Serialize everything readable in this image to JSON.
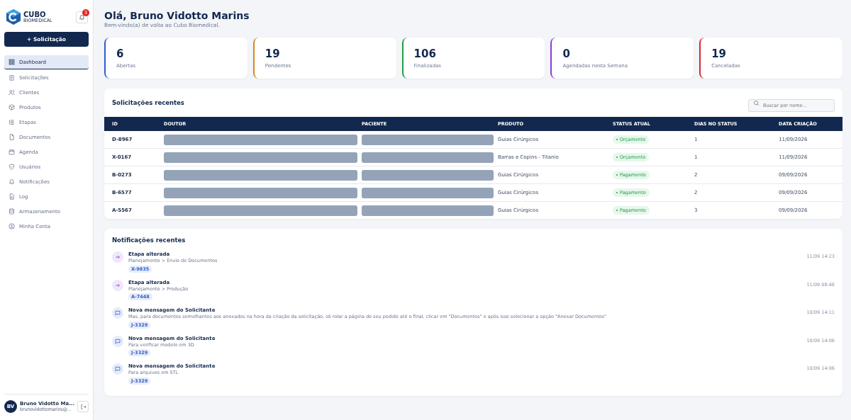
{
  "sidebar": {
    "logo": {
      "name": "CUBO",
      "tagline": "BIOMEDICAL"
    },
    "notification_count": "3",
    "new_button": {
      "icon": "+",
      "label": "Solicitação"
    },
    "items": [
      {
        "label": "Dashboard",
        "selected": true
      },
      {
        "label": "Solicitações",
        "selected": false
      },
      {
        "label": "Clientes",
        "selected": false
      },
      {
        "label": "Produtos",
        "selected": false
      },
      {
        "label": "Etapas",
        "selected": false
      },
      {
        "label": "Documentos",
        "selected": false
      },
      {
        "label": "Agenda",
        "selected": false
      },
      {
        "label": "Usuários",
        "selected": false
      },
      {
        "label": "Notificações",
        "selected": false
      },
      {
        "label": "Log",
        "selected": false
      },
      {
        "label": "Armazenamento",
        "selected": false
      },
      {
        "label": "Minha Conta",
        "selected": false
      }
    ],
    "user": {
      "initials": "BV",
      "name": "Bruno Vidotto Ma...",
      "email": "brunovidottomarins@..."
    }
  },
  "header": {
    "title": "Olá, Bruno Vidotto Marins",
    "subtitle": "Bem-vindo(a) de volta ao Cubo Biomedical."
  },
  "stats": [
    {
      "value": "6",
      "label": "Abertas",
      "color": "#2f5fd0"
    },
    {
      "value": "19",
      "label": "Pendentes",
      "color": "#d98a1c"
    },
    {
      "value": "106",
      "label": "Finalizadas",
      "color": "#1f9d4a"
    },
    {
      "value": "0",
      "label": "Agendadas nesta Semana",
      "color": "#8b3fd9"
    },
    {
      "value": "19",
      "label": "Canceladas",
      "color": "#d42b2b"
    }
  ],
  "requests": {
    "title": "Solicitações recentes",
    "search": {
      "placeholder": "Buscar por nome..."
    },
    "columns": [
      "ID",
      "DOUTOR",
      "PACIENTE",
      "PRODUTO",
      "STATUS ATUAL",
      "DIAS NO STATUS",
      "DATA CRIAÇÃO"
    ],
    "rows": [
      {
        "id": "D-8967",
        "doctor_redacted": true,
        "patient_redacted": true,
        "product": "Guias Cirúrgicos",
        "status": "Orçamento",
        "days": "1",
        "created": "11/09/2026"
      },
      {
        "id": "X-0167",
        "doctor_redacted": true,
        "patient_redacted": true,
        "product": "Barras e Copins - Titanio",
        "status": "Orçamento",
        "days": "1",
        "created": "11/09/2026"
      },
      {
        "id": "B-0273",
        "doctor_redacted": true,
        "patient_redacted": true,
        "product": "Guias Cirúrgicos",
        "status": "Pagamento",
        "days": "2",
        "created": "09/09/2026"
      },
      {
        "id": "B-6577",
        "doctor_redacted": true,
        "patient_redacted": true,
        "product": "Guias Cirúrgicos",
        "status": "Pagamento",
        "days": "2",
        "created": "09/09/2026"
      },
      {
        "id": "A-5567",
        "doctor_redacted": true,
        "patient_redacted": true,
        "product": "Guias Cirúrgicos",
        "status": "Pagamento",
        "days": "3",
        "created": "09/09/2026"
      }
    ]
  },
  "notifications": {
    "title": "Notificações recentes",
    "items": [
      {
        "kind": "stage",
        "title": "Etapa alterada",
        "text": "Planejamento > Envio de Documentos",
        "tag": "X-9835",
        "time": "11/09 14:23"
      },
      {
        "kind": "stage",
        "title": "Etapa alterada",
        "text": "Planejamento > Produção",
        "tag": "A-7448",
        "time": "11/09 08:48"
      },
      {
        "kind": "message",
        "title": "Nova mensagem do Solicitante",
        "text": "Mas, para documentos semelhantes aos anexados na hora da criação da solicitação, só rolar a página do seu pedido até o final, clicar em \"Documentos\" e após isso selecionar a opção \"Anexar Documentos\"",
        "tag": "J-3329",
        "time": "10/09 14:11"
      },
      {
        "kind": "message",
        "title": "Nova mensagem do Solicitante",
        "text": "Para verificar modelo em 3D",
        "tag": "J-3329",
        "time": "10/09 14:06"
      },
      {
        "kind": "message",
        "title": "Nova mensagem do Solicitante",
        "text": "Para arquivos em STL",
        "tag": "J-3329",
        "time": "10/09 14:06"
      }
    ]
  }
}
